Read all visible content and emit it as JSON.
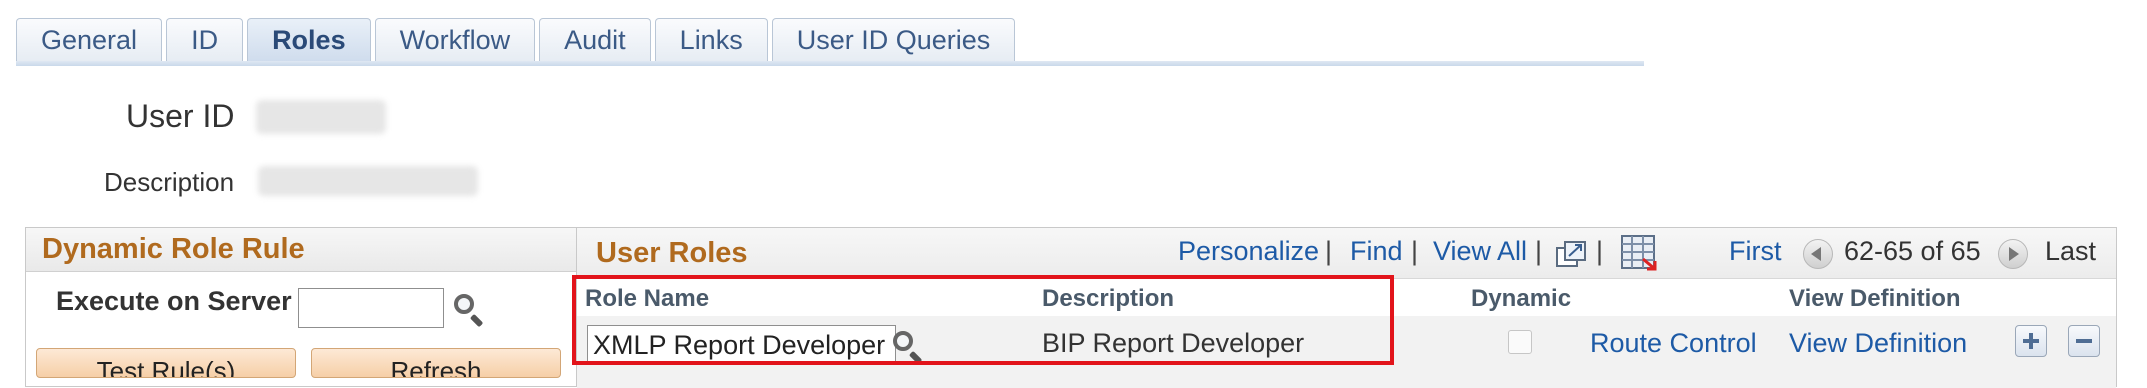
{
  "tabs": [
    "General",
    "ID",
    "Roles",
    "Workflow",
    "Audit",
    "Links",
    "User ID Queries"
  ],
  "active_tab": "Roles",
  "header": {
    "user_id_label": "User ID",
    "description_label": "Description"
  },
  "dynamic_role_rule": {
    "title": "Dynamic Role Rule",
    "execute_label": "Execute on Server",
    "execute_value": "",
    "test_rules_label": "Test Rule(s)",
    "refresh_label": "Refresh"
  },
  "user_roles": {
    "title": "User Roles",
    "toolbar": {
      "personalize": "Personalize",
      "find": "Find",
      "view_all": "View All",
      "first": "First",
      "range": "62-65 of 65",
      "last": "Last"
    },
    "columns": {
      "role_name": "Role Name",
      "description": "Description",
      "dynamic": "Dynamic",
      "view_definition": "View Definition"
    },
    "rows": [
      {
        "role_name": "XMLP Report Developer",
        "description": "BIP Report Developer",
        "dynamic": false,
        "route_control": "Route Control",
        "view_definition": "View Definition"
      }
    ]
  },
  "colors": {
    "title_orange": "#b06a1e",
    "link_blue": "#1d5aa6",
    "highlight_red": "#e2141b"
  }
}
